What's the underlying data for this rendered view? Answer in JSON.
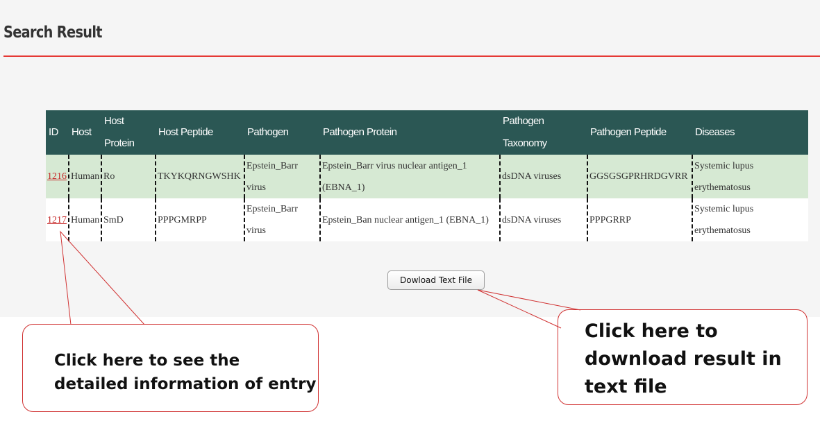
{
  "page": {
    "title": "Search Result"
  },
  "table": {
    "columns": [
      "ID",
      "Host",
      "Host Protein",
      "Host Peptide",
      "Pathogen",
      "Pathogen Protein",
      "Pathogen Taxonomy",
      "Pathogen Peptide",
      "Diseases"
    ],
    "rows": [
      [
        "1216",
        "Human",
        "Ro",
        "TKYKQRNGWSHK",
        "Epstein_Barr virus",
        "Epstein_Barr virus nuclear antigen_1 (EBNA_1)",
        "dsDNA viruses",
        "GGSGSGPRHRDGVRR",
        "Systemic lupus erythematosus"
      ],
      [
        "1217",
        "Human",
        "SmD",
        "PPPGMRPP",
        "Epstein_Barr virus",
        "Epstein_Ban nuclear antigen_1 (EBNA_1)",
        "dsDNA viruses",
        "PPPGRRP",
        "Systemic lupus erythematosus"
      ]
    ]
  },
  "download": {
    "label": "Dowload Text File"
  },
  "callouts": {
    "left": "Click here to see the detailed information of entry",
    "right": "Click here to download result in text file"
  },
  "colors": {
    "header_bg": "#2b5754",
    "row_highlight": "#d6e9d3",
    "accent": "#e53935"
  }
}
